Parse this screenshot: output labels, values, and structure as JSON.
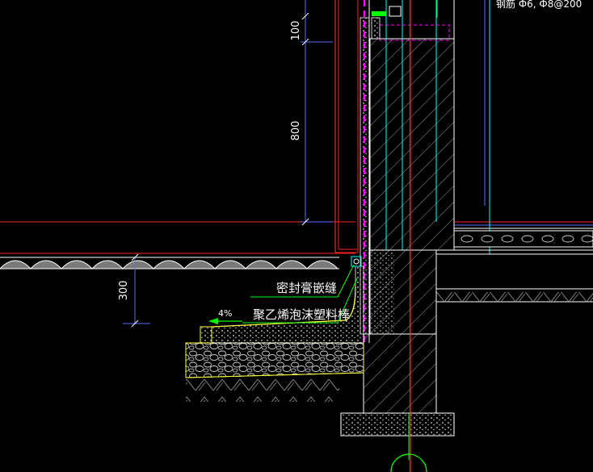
{
  "dimensions": {
    "d100": "100",
    "d800": "800",
    "d300": "300"
  },
  "annotations": {
    "top_right_text": "钢筋 Ф6, Ф8@200",
    "sealant": "密封膏嵌缝",
    "foam_rod": "聚乙烯泡沫塑料棒",
    "slope": "4%"
  },
  "colors": {
    "background": "#000000",
    "red": "#ff2020",
    "white": "#ffffff",
    "cyan": "#00ffff",
    "magenta": "#ff00ff",
    "green": "#00ff00",
    "yellow": "#ffff40",
    "blue": "#5a6cff",
    "gray": "#8a8a8a"
  }
}
